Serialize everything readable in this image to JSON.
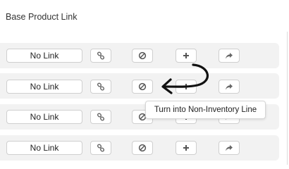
{
  "section": {
    "title": "Base Product Link"
  },
  "rows": [
    {
      "link_label": "No Link"
    },
    {
      "link_label": "No Link"
    },
    {
      "link_label": "No Link"
    },
    {
      "link_label": "No Link"
    }
  ],
  "icons": {
    "link": "link-icon",
    "no_inventory": "ban-icon",
    "add": "plus-icon",
    "share": "share-arrow-icon"
  },
  "tooltip": {
    "text": "Turn into Non-Inventory Line"
  },
  "colors": {
    "row_alt_bg": "#f2f2f2",
    "border": "#cfcfcf",
    "arrow": "#111111"
  }
}
